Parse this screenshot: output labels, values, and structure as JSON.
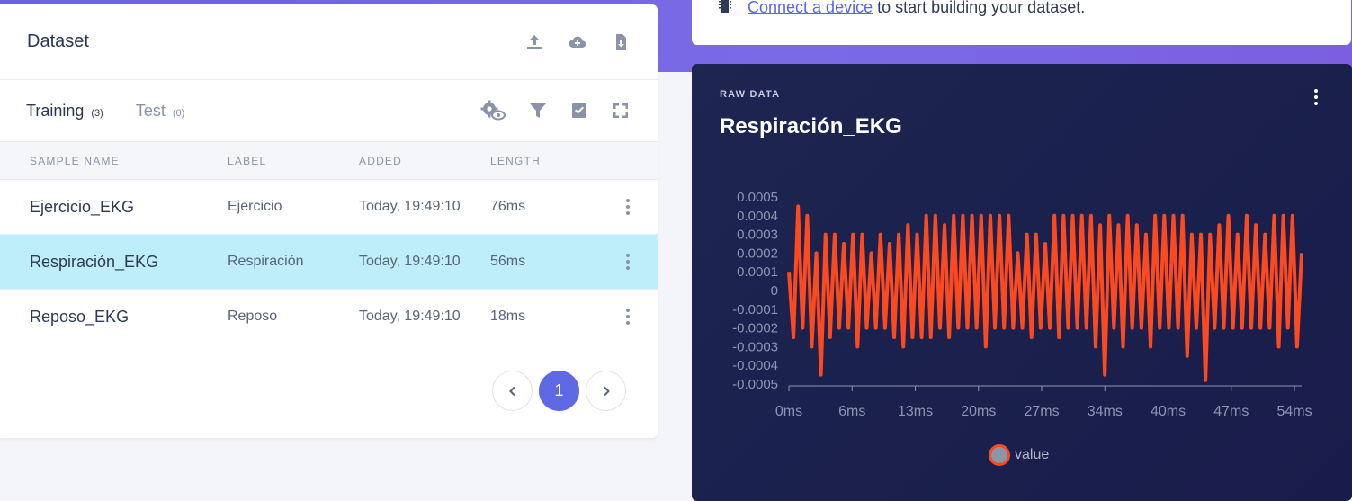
{
  "connect": {
    "link_text": "Connect a device",
    "rest_text": " to start building your dataset."
  },
  "dataset": {
    "title": "Dataset",
    "header_icons": [
      "upload-icon",
      "cloud-upload-icon",
      "download-icon"
    ],
    "tabs": [
      {
        "label": "Training",
        "count": "(3)",
        "active": true
      },
      {
        "label": "Test",
        "count": "(0)",
        "active": false
      }
    ],
    "tab_icons": [
      "settings-eye-icon",
      "filter-icon",
      "select-check-icon",
      "fullscreen-icon"
    ],
    "columns": [
      "SAMPLE NAME",
      "LABEL",
      "ADDED",
      "LENGTH"
    ],
    "rows": [
      {
        "name": "Ejercicio_EKG",
        "label": "Ejercicio",
        "added": "Today, 19:49:10",
        "length": "76ms",
        "selected": false
      },
      {
        "name": "Respiración_EKG",
        "label": "Respiración",
        "added": "Today, 19:49:10",
        "length": "56ms",
        "selected": true
      },
      {
        "name": "Reposo_EKG",
        "label": "Reposo",
        "added": "Today, 19:49:10",
        "length": "18ms",
        "selected": false
      }
    ],
    "pagination": {
      "current": "1"
    }
  },
  "raw_data": {
    "eyebrow": "RAW DATA",
    "title": "Respiración_EKG",
    "legend": "value",
    "colors": {
      "line": "#fc4a1e",
      "axis": "#8d95b3"
    }
  },
  "chart_data": {
    "type": "line",
    "xlabel": "",
    "ylabel": "",
    "x_tick_labels": [
      "0ms",
      "6ms",
      "13ms",
      "20ms",
      "27ms",
      "34ms",
      "40ms",
      "47ms",
      "54ms"
    ],
    "y_tick_labels": [
      "0.0005",
      "0.0004",
      "0.0003",
      "0.0002",
      "0.0001",
      "0",
      "-0.0001",
      "-0.0002",
      "-0.0003",
      "-0.0004",
      "-0.0005"
    ],
    "ylim": [
      -0.0005,
      0.0005
    ],
    "xlim": [
      0,
      56
    ],
    "grid": false,
    "legend_position": "bottom",
    "series": [
      {
        "name": "value",
        "x": [
          0,
          0.5,
          1,
          1.5,
          2,
          2.5,
          3,
          3.5,
          4,
          4.5,
          5,
          5.5,
          6,
          6.5,
          7,
          7.5,
          8,
          8.5,
          9,
          9.5,
          10,
          10.5,
          11,
          11.5,
          12,
          12.5,
          13,
          13.5,
          14,
          14.5,
          15,
          15.5,
          16,
          16.5,
          17,
          17.5,
          18,
          18.5,
          19,
          19.5,
          20,
          20.5,
          21,
          21.5,
          22,
          22.5,
          23,
          23.5,
          24,
          24.5,
          25,
          25.5,
          26,
          26.5,
          27,
          27.5,
          28,
          28.5,
          29,
          29.5,
          30,
          30.5,
          31,
          31.5,
          32,
          32.5,
          33,
          33.5,
          34,
          34.5,
          35,
          35.5,
          36,
          36.5,
          37,
          37.5,
          38,
          38.5,
          39,
          39.5,
          40,
          40.5,
          41,
          41.5,
          42,
          42.5,
          43,
          43.5,
          44,
          44.5,
          45,
          45.5,
          46,
          46.5,
          47,
          47.5,
          48,
          48.5,
          49,
          49.5,
          50,
          50.5,
          51,
          51.5,
          52,
          52.5,
          53,
          53.5,
          54,
          54.5,
          55,
          55.5,
          56
        ],
        "values": [
          0.0001,
          -0.00025,
          0.00045,
          -0.0002,
          0.0004,
          -0.0003,
          0.0002,
          -0.00045,
          0.0003,
          -0.00025,
          0.0003,
          -0.0002,
          0.00025,
          -0.0002,
          0.0003,
          -0.0003,
          0.0003,
          -0.0002,
          0.0002,
          -0.0002,
          0.0003,
          -0.0002,
          0.00025,
          -0.00025,
          0.0003,
          -0.0003,
          0.00035,
          -0.00025,
          0.0003,
          -0.00025,
          0.0004,
          -0.00025,
          0.0004,
          -0.0002,
          0.00035,
          -0.00025,
          0.0004,
          -0.0002,
          0.0004,
          -0.0002,
          0.0004,
          -0.0002,
          0.0004,
          -0.0003,
          0.0004,
          -0.0002,
          0.0004,
          -0.0002,
          0.0004,
          -0.0002,
          0.0002,
          -0.0002,
          0.0003,
          -0.00025,
          0.0003,
          -0.0002,
          0.00025,
          -0.0002,
          0.0004,
          -0.00025,
          0.0004,
          -0.0002,
          0.0004,
          -0.0002,
          0.0004,
          -0.0002,
          0.0004,
          -0.0003,
          0.00035,
          -0.00045,
          0.0004,
          -0.0002,
          0.00035,
          -0.0003,
          0.0004,
          -0.0002,
          0.00035,
          -0.0002,
          0.0003,
          -0.0003,
          0.0004,
          -0.0002,
          0.0004,
          -0.0002,
          0.0004,
          -0.0002,
          0.0004,
          -0.00035,
          0.0003,
          -0.0002,
          0.0003,
          -0.00048,
          0.0003,
          -0.0002,
          0.00035,
          -0.0002,
          0.0004,
          -0.0002,
          0.0003,
          -0.0002,
          0.0004,
          -0.0002,
          0.00035,
          -0.0002,
          0.0003,
          -0.0002,
          0.0004,
          -0.0003,
          0.0004,
          -0.0002,
          0.0004,
          -0.0003,
          0.0002
        ]
      }
    ]
  }
}
